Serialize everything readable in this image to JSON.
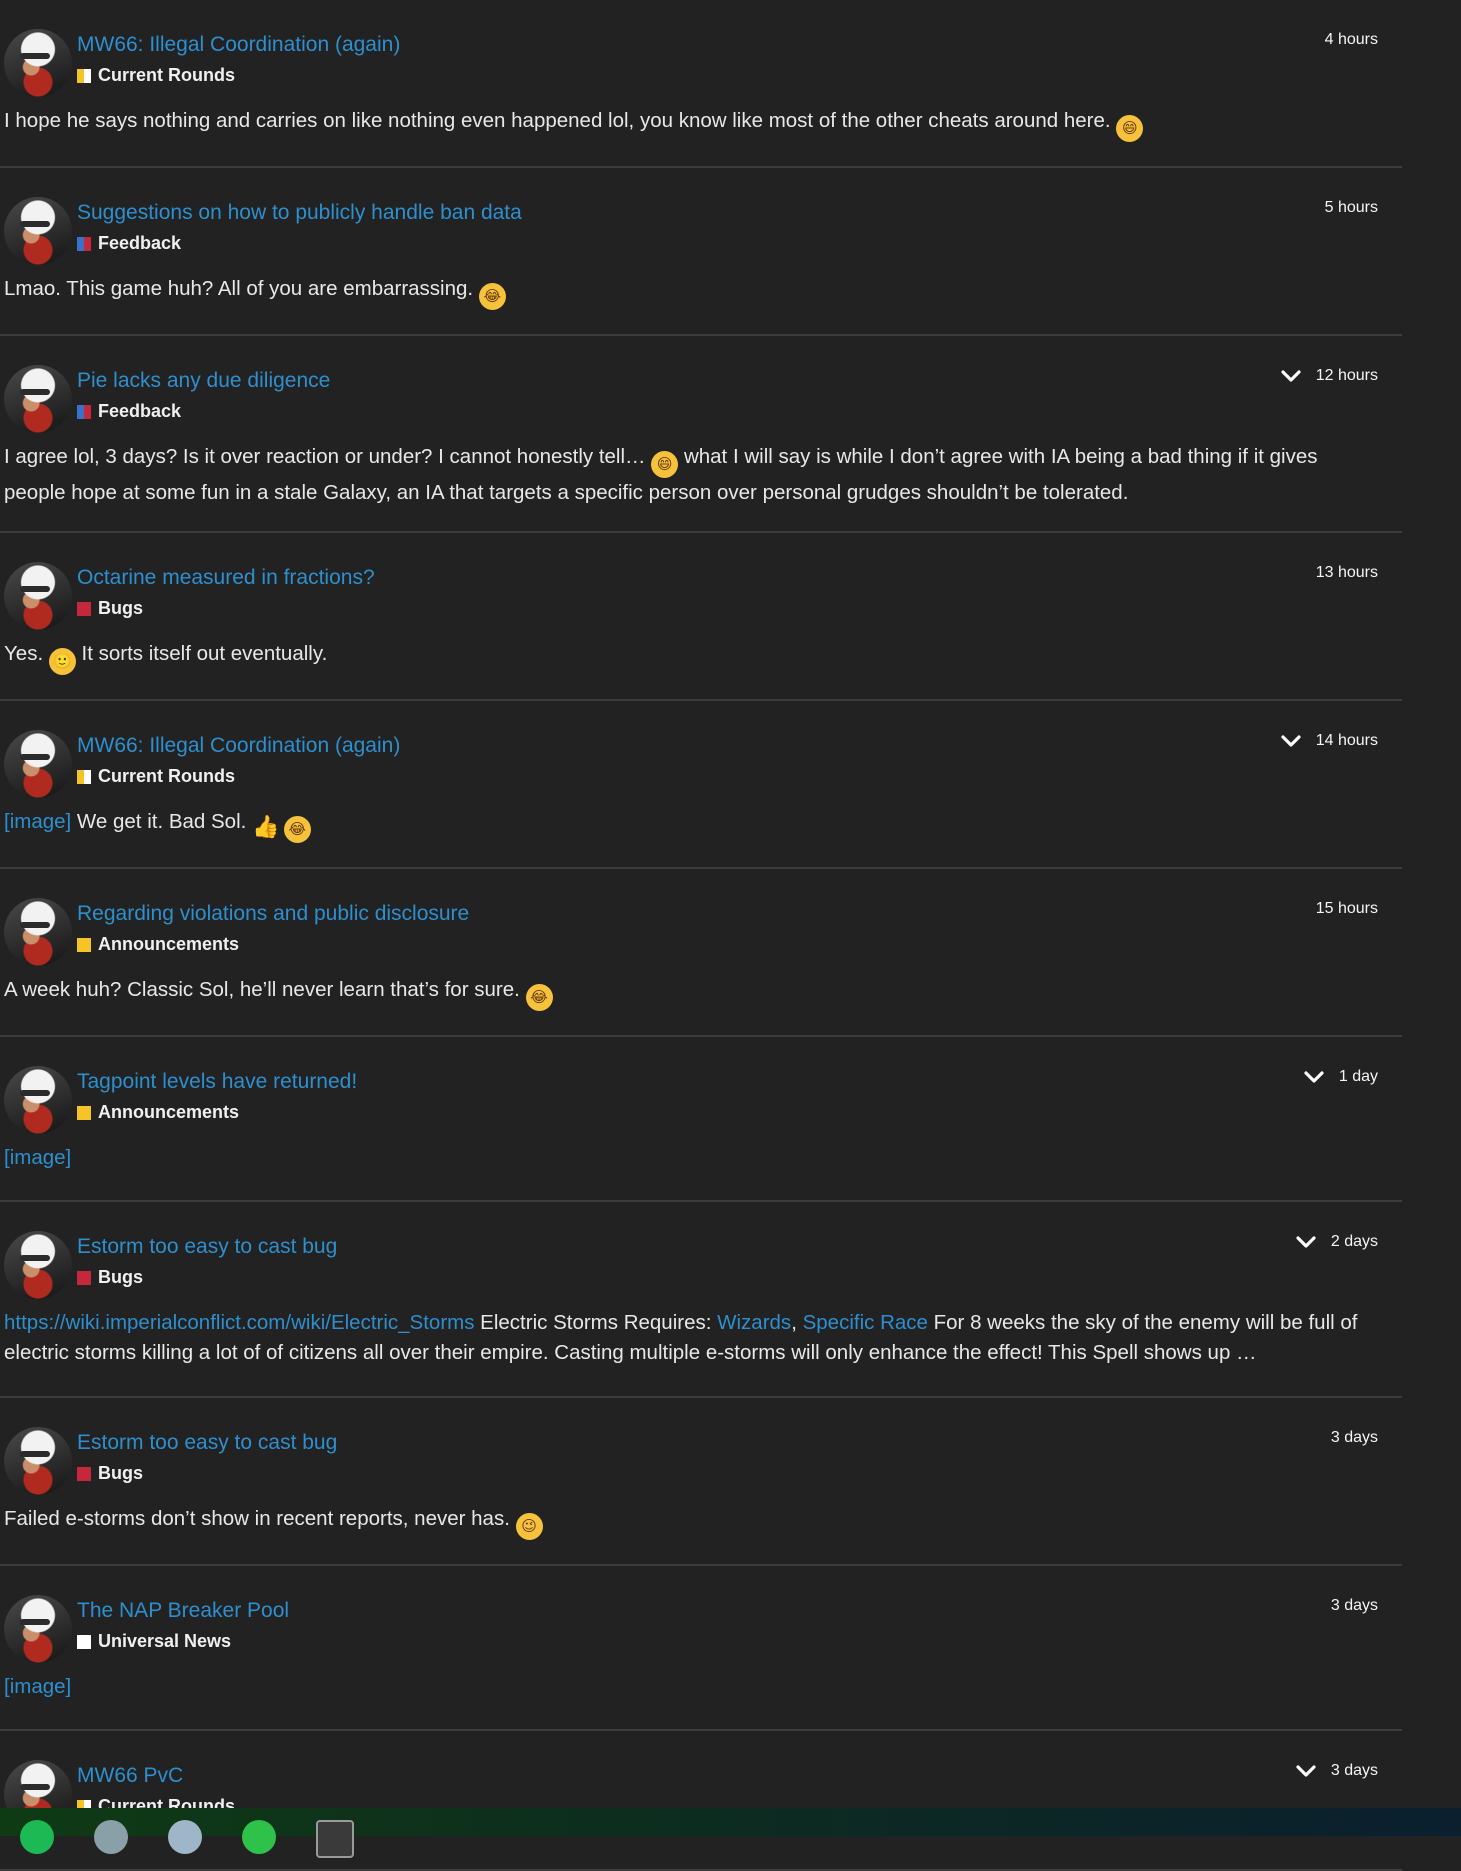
{
  "posts": [
    {
      "title": "MW66: Illegal Coordination (again)",
      "category": "Current Rounds",
      "category_colors": [
        "#f7c427",
        "#ffffff"
      ],
      "time": "4 hours",
      "expandable": false,
      "body": [
        {
          "type": "text",
          "value": "I hope he says nothing and carries on like nothing even happened lol, you know like most of the other cheats around here. "
        },
        {
          "type": "emoji",
          "name": "grinning-face-icon",
          "glyph": "😄"
        }
      ]
    },
    {
      "title": "Suggestions on how to publicly handle ban data",
      "category": "Feedback",
      "category_colors": [
        "#3673c9",
        "#c6283b"
      ],
      "time": "5 hours",
      "expandable": false,
      "body": [
        {
          "type": "text",
          "value": "Lmao. This game huh? All of you are embarrassing. "
        },
        {
          "type": "emoji",
          "name": "tears-of-joy-icon",
          "glyph": "😂"
        }
      ]
    },
    {
      "title": "Pie lacks any due diligence",
      "category": "Feedback",
      "category_colors": [
        "#3673c9",
        "#c6283b"
      ],
      "time": "12 hours",
      "expandable": true,
      "body": [
        {
          "type": "text",
          "value": "I agree lol, 3 days? Is it over reaction or under? I cannot honestly tell… "
        },
        {
          "type": "emoji",
          "name": "grinning-face-icon",
          "glyph": "😄"
        },
        {
          "type": "text",
          "value": " what I will say is while I don’t agree with IA being a bad thing if it gives people hope at some fun in a stale Galaxy, an IA that targets a specific person over personal grudges shouldn’t be tolerated."
        }
      ]
    },
    {
      "title": "Octarine measured in fractions?",
      "category": "Bugs",
      "category_colors": [
        "#c6283b",
        "#c6283b"
      ],
      "time": "13 hours",
      "expandable": false,
      "body": [
        {
          "type": "text",
          "value": "Yes. "
        },
        {
          "type": "emoji",
          "name": "slight-smile-icon",
          "glyph": "🙂"
        },
        {
          "type": "text",
          "value": " It sorts itself out eventually."
        }
      ]
    },
    {
      "title": "MW66: Illegal Coordination (again)",
      "category": "Current Rounds",
      "category_colors": [
        "#f7c427",
        "#ffffff"
      ],
      "time": "14 hours",
      "expandable": true,
      "body": [
        {
          "type": "link",
          "value": "[image]"
        },
        {
          "type": "text",
          "value": " We get it. Bad Sol. "
        },
        {
          "type": "thumb",
          "name": "thumbs-up-icon",
          "glyph": "👍"
        },
        {
          "type": "text",
          "value": " "
        },
        {
          "type": "emoji",
          "name": "tears-of-joy-icon",
          "glyph": "😂"
        }
      ]
    },
    {
      "title": "Regarding violations and public disclosure",
      "category": "Announcements",
      "category_colors": [
        "#f7c427",
        "#f7c427"
      ],
      "time": "15 hours",
      "expandable": false,
      "body": [
        {
          "type": "text",
          "value": "A week huh? Classic Sol, he’ll never learn that’s for sure. "
        },
        {
          "type": "emoji",
          "name": "tears-of-joy-icon",
          "glyph": "😂"
        }
      ]
    },
    {
      "title": "Tagpoint levels have returned!",
      "category": "Announcements",
      "category_colors": [
        "#f7c427",
        "#f7c427"
      ],
      "time": "1 day",
      "expandable": true,
      "body": [
        {
          "type": "link",
          "value": "[image]"
        }
      ]
    },
    {
      "title": "Estorm too easy to cast bug",
      "category": "Bugs",
      "category_colors": [
        "#c6283b",
        "#c6283b"
      ],
      "time": "2 days",
      "expandable": true,
      "body": [
        {
          "type": "link",
          "value": "https://wiki.imperialconflict.com/wiki/Electric_Storms"
        },
        {
          "type": "text",
          "value": " Electric Storms Requires: "
        },
        {
          "type": "link",
          "value": "Wizards"
        },
        {
          "type": "text",
          "value": ", "
        },
        {
          "type": "link",
          "value": "Specific Race"
        },
        {
          "type": "text",
          "value": " For 8 weeks the sky of the enemy will be full of electric storms killing a lot of of citizens all over their empire. Casting multiple e-storms will only enhance the effect! This Spell shows up …"
        }
      ]
    },
    {
      "title": "Estorm too easy to cast bug",
      "category": "Bugs",
      "category_colors": [
        "#c6283b",
        "#c6283b"
      ],
      "time": "3 days",
      "expandable": false,
      "body": [
        {
          "type": "text",
          "value": "Failed e-storms don’t show in recent reports, never has. "
        },
        {
          "type": "emoji",
          "name": "winking-face-icon",
          "glyph": "😉"
        }
      ]
    },
    {
      "title": "The NAP Breaker Pool",
      "category": "Universal News",
      "category_colors": [
        "#ffffff",
        "#ffffff"
      ],
      "time": "3 days",
      "expandable": false,
      "body": [
        {
          "type": "link",
          "value": "[image]"
        }
      ]
    },
    {
      "title": "MW66 PvC",
      "category": "Current Rounds",
      "category_colors": [
        "#f7c427",
        "#ffffff"
      ],
      "time": "3 days",
      "expandable": true,
      "body": []
    }
  ],
  "taskbar": {
    "icons": [
      {
        "name": "spotify-icon",
        "color": "#1db954"
      },
      {
        "name": "app-icon",
        "color": "#8aa0a8"
      },
      {
        "name": "file-icon",
        "color": "#9fb6c8"
      },
      {
        "name": "xbox-icon",
        "color": "#2ec24a"
      },
      {
        "name": "steam-icon",
        "color": "#3a3a3a"
      }
    ]
  }
}
